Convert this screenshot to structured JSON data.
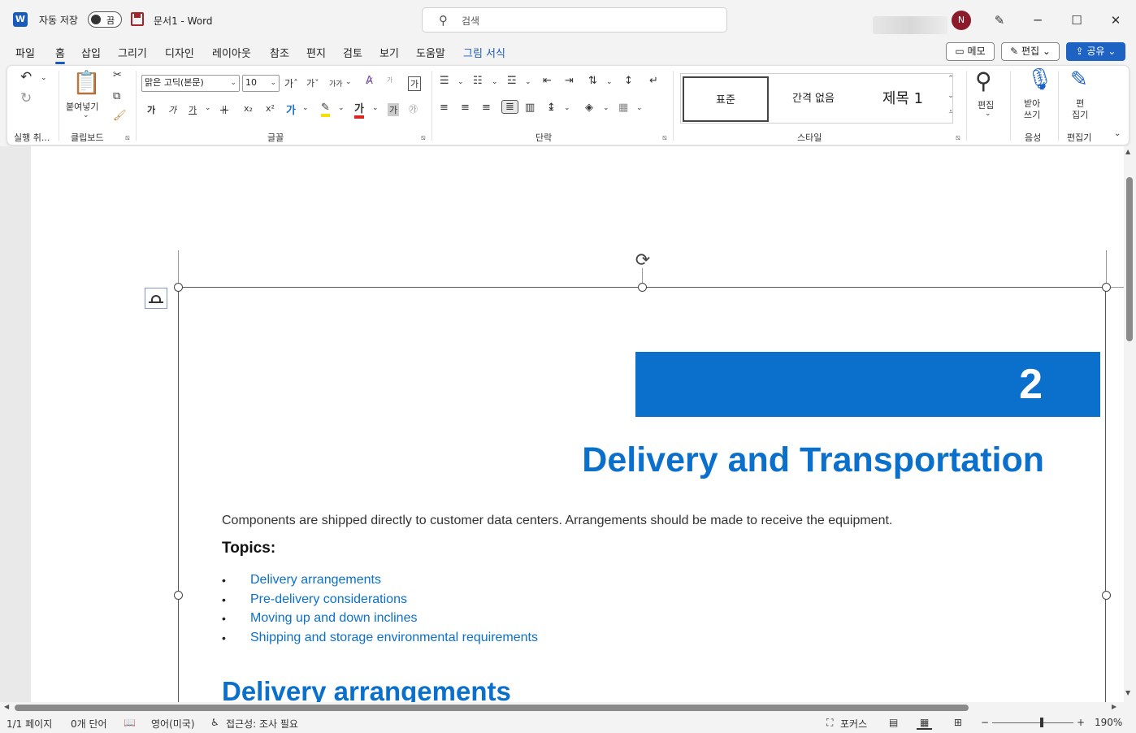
{
  "titlebar": {
    "app_icon": "word-icon",
    "app_letter": "W",
    "autosave_label": "자동 저장",
    "autosave_state": "끔",
    "doc_title": "문서1  -  Word",
    "search_placeholder": "검색",
    "avatar_initial": "N",
    "minimize": "─",
    "maximize": "☐",
    "close": "✕"
  },
  "tabs": [
    {
      "label": "파일"
    },
    {
      "label": "홈"
    },
    {
      "label": "삽입"
    },
    {
      "label": "그리기"
    },
    {
      "label": "디자인"
    },
    {
      "label": "레이아웃"
    },
    {
      "label": "참조"
    },
    {
      "label": "편지"
    },
    {
      "label": "검토"
    },
    {
      "label": "보기"
    },
    {
      "label": "도움말"
    },
    {
      "label": "그림 서식"
    }
  ],
  "header_buttons": {
    "memo": "▭ 메모",
    "edit": "✎ 편집 ⌄",
    "share": "⇪ 공유  ⌄"
  },
  "ribbon": {
    "groups": {
      "undo": "실행 취...",
      "clipboard": "클립보드",
      "font": "글꼴",
      "paragraph": "단락",
      "styles": "스타일",
      "voice": "음성",
      "editor": "편집기"
    },
    "paste_label": "붙여넣기",
    "font_name": "맑은 고딕(본문)",
    "font_size": "10",
    "font_buttons": {
      "grow": "가ˆ",
      "shrink": "가ˇ",
      "case": "가가",
      "bold": "가",
      "italic": "가",
      "underline": "가",
      "strike": "ㅐ",
      "sub": "x₂",
      "sup": "x²",
      "phonetic": "가",
      "border": "가"
    },
    "styles": [
      "표준",
      "간격 없음",
      "제목 1"
    ],
    "find_label": "편집",
    "dictate_label": "받아\n쓰기",
    "editor_label": "편\n집기"
  },
  "document": {
    "chapter_number": "2",
    "chapter_title": "Delivery and Transportation",
    "intro": "Components are shipped directly to customer data centers. Arrangements should be made to receive the equipment.",
    "topics_heading": "Topics:",
    "topics": [
      "Delivery arrangements",
      "Pre-delivery considerations",
      "Moving up and down inclines",
      "Shipping and storage environmental requirements"
    ],
    "section_title": "Delivery arrangements"
  },
  "statusbar": {
    "page": "1/1 페이지",
    "words": "0개 단어",
    "language": "영어(미국)",
    "accessibility": "접근성: 조사 필요",
    "focus": "포커스",
    "zoom": "190%"
  },
  "colors": {
    "accent": "#185abd",
    "doc_blue": "#0b70cc",
    "avatar": "#8b1a2b"
  }
}
